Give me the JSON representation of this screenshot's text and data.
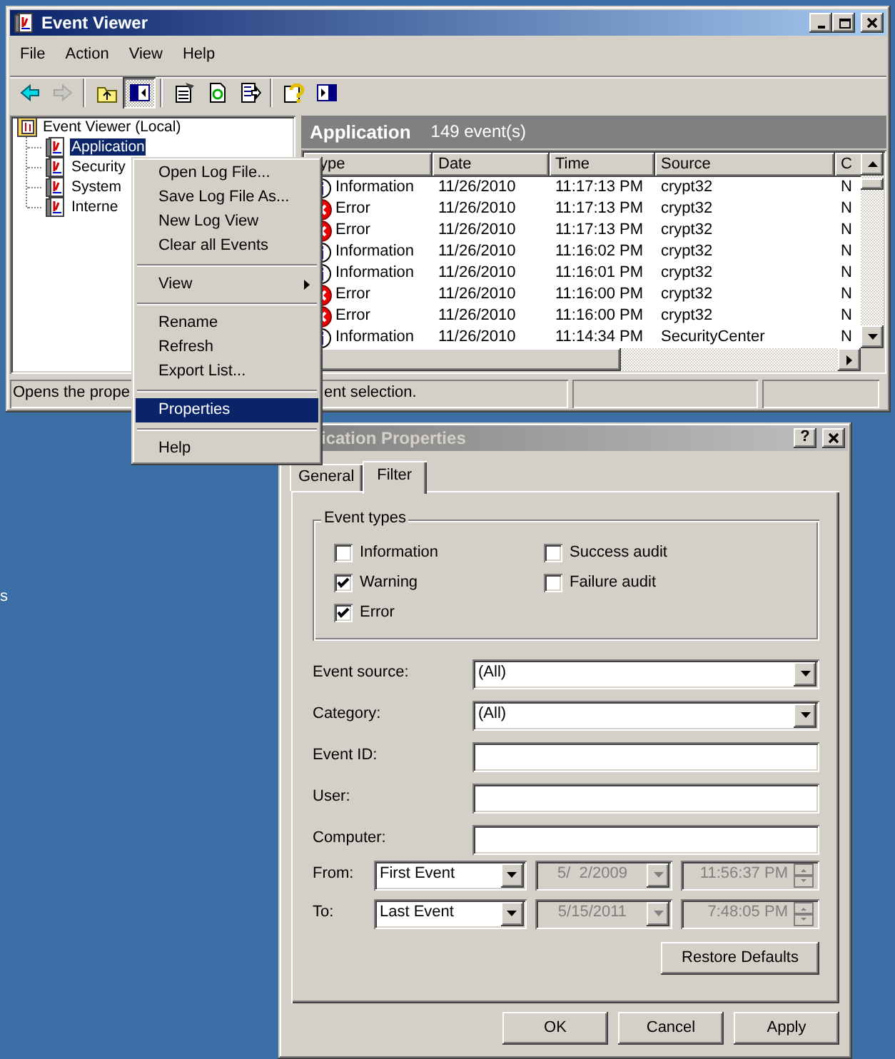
{
  "desktop": {
    "label": "s"
  },
  "main_window": {
    "title": "Event Viewer",
    "active": true,
    "menu": [
      "File",
      "Action",
      "View",
      "Help"
    ],
    "toolbar": [
      {
        "kind": "back",
        "disabled": false,
        "pressed": false
      },
      {
        "kind": "forward",
        "disabled": true,
        "pressed": false
      },
      {
        "kind": "separator"
      },
      {
        "kind": "up",
        "disabled": false,
        "pressed": false
      },
      {
        "kind": "tree",
        "disabled": false,
        "pressed": true
      },
      {
        "kind": "separator"
      },
      {
        "kind": "properties",
        "disabled": false,
        "pressed": false
      },
      {
        "kind": "refresh",
        "disabled": false,
        "pressed": false
      },
      {
        "kind": "export",
        "disabled": false,
        "pressed": false
      },
      {
        "kind": "separator"
      },
      {
        "kind": "help",
        "disabled": false,
        "pressed": false
      },
      {
        "kind": "pane",
        "disabled": false,
        "pressed": false
      }
    ],
    "tree": {
      "label": "Event Viewer (Local)",
      "children": [
        {
          "label": "Application",
          "selected": true
        },
        {
          "label": "Security",
          "selected": false
        },
        {
          "label": "System",
          "selected": false
        },
        {
          "label": "Interne",
          "selected": false
        }
      ]
    },
    "list": {
      "title": "Application",
      "count": "149 event(s)",
      "columns": [
        "ype",
        "Date",
        "Time",
        "Source",
        "C"
      ],
      "rows": [
        {
          "kind": "information",
          "cells": [
            "Information",
            "11/26/2010",
            "11:17:13 PM",
            "crypt32",
            "N"
          ]
        },
        {
          "kind": "error",
          "cells": [
            "Error",
            "11/26/2010",
            "11:17:13 PM",
            "crypt32",
            "N"
          ]
        },
        {
          "kind": "error",
          "cells": [
            "Error",
            "11/26/2010",
            "11:17:13 PM",
            "crypt32",
            "N"
          ]
        },
        {
          "kind": "information",
          "cells": [
            "Information",
            "11/26/2010",
            "11:16:02 PM",
            "crypt32",
            "N"
          ]
        },
        {
          "kind": "information",
          "cells": [
            "Information",
            "11/26/2010",
            "11:16:01 PM",
            "crypt32",
            "N"
          ]
        },
        {
          "kind": "error",
          "cells": [
            "Error",
            "11/26/2010",
            "11:16:00 PM",
            "crypt32",
            "N"
          ]
        },
        {
          "kind": "error",
          "cells": [
            "Error",
            "11/26/2010",
            "11:16:00 PM",
            "crypt32",
            "N"
          ]
        },
        {
          "kind": "information",
          "cells": [
            "Information",
            "11/26/2010",
            "11:14:34 PM",
            "SecurityCenter",
            "N"
          ]
        }
      ]
    },
    "status_bar": [
      "Opens the prope",
      "ent selection."
    ]
  },
  "context_menu": [
    {
      "kind": "item",
      "label": "Open Log File...",
      "selected": false
    },
    {
      "kind": "item",
      "label": "Save Log File As...",
      "selected": false
    },
    {
      "kind": "item",
      "label": "New Log View",
      "selected": false
    },
    {
      "kind": "item",
      "label": "Clear all Events",
      "selected": false
    },
    {
      "kind": "separator"
    },
    {
      "kind": "submenu",
      "label": "View",
      "selected": false
    },
    {
      "kind": "separator"
    },
    {
      "kind": "item",
      "label": "Rename",
      "selected": false
    },
    {
      "kind": "item",
      "label": "Refresh",
      "selected": false
    },
    {
      "kind": "item",
      "label": "Export List...",
      "selected": false
    },
    {
      "kind": "separator"
    },
    {
      "kind": "item",
      "label": "Properties",
      "selected": true
    },
    {
      "kind": "separator"
    },
    {
      "kind": "item",
      "label": "Help",
      "selected": false
    }
  ],
  "dialog": {
    "title": "ication Properties",
    "active": false,
    "help_glyph": "?",
    "tabs": [
      {
        "label": "General",
        "selected": false
      },
      {
        "label": "Filter",
        "selected": true
      }
    ],
    "group": {
      "title": "Event types",
      "options": [
        {
          "label": "Information",
          "checked": false
        },
        {
          "label": "Warning",
          "checked": true
        },
        {
          "label": "Error",
          "checked": true
        },
        {
          "label": "Success audit",
          "checked": false
        },
        {
          "label": "Failure audit",
          "checked": false
        }
      ]
    },
    "fields": [
      {
        "kind": "select",
        "label": "Event source:",
        "value": "(All)"
      },
      {
        "kind": "select",
        "label": "Category:",
        "value": "(All)"
      },
      {
        "kind": "text",
        "label": "Event ID:"
      },
      {
        "kind": "text",
        "label": "User:"
      },
      {
        "kind": "text",
        "label": "Computer:"
      }
    ],
    "ranges": [
      {
        "label": "From:",
        "mode": "First Event",
        "date": "5/  2/2009",
        "time": "11:56:37 PM",
        "disabled": true
      },
      {
        "label": "To:",
        "mode": "Last Event",
        "date": "5/15/2011",
        "time": "7:48:05 PM",
        "disabled": true
      }
    ],
    "restore_button": "Restore Defaults",
    "buttons": [
      "OK",
      "Cancel",
      "Apply"
    ]
  }
}
